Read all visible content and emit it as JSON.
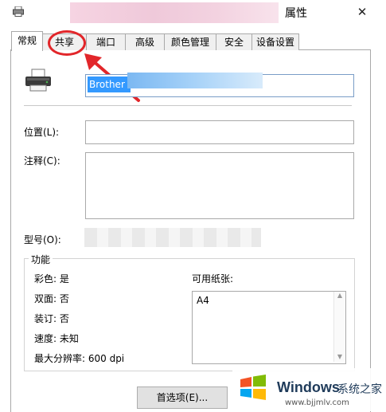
{
  "window": {
    "title": "属性",
    "close_glyph": "✕"
  },
  "tabs": [
    "常规",
    "共享",
    "端口",
    "高级",
    "颜色管理",
    "安全",
    "设备设置"
  ],
  "active_tab": "常规",
  "general": {
    "printer_name": "Brother",
    "location_label": "位置(L):",
    "location_value": "",
    "comment_label": "注释(C):",
    "comment_value": "",
    "model_label": "型号(O):",
    "features_title": "功能",
    "features": [
      "彩色: 是",
      "双面: 否",
      "装订: 否",
      "速度: 未知",
      "最大分辨率: 600 dpi"
    ],
    "paper_label": "可用纸张:",
    "paper_list": [
      "A4"
    ],
    "preferences_button": "首选项(E)..."
  },
  "annotation": {
    "color": "#e2262a",
    "target": "共享"
  },
  "watermark": {
    "brand": "Windows",
    "brand_suffix": "系统之家",
    "url": "www.bjjmlv.com"
  }
}
